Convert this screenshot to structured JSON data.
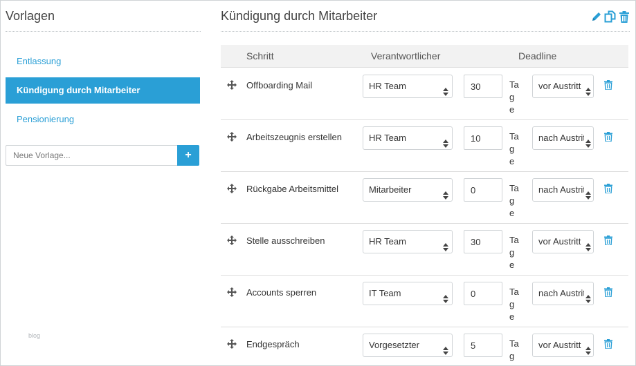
{
  "sidebar": {
    "title": "Vorlagen",
    "items": [
      {
        "label": "Entlassung",
        "active": false
      },
      {
        "label": "Kündigung durch Mitarbeiter",
        "active": true
      },
      {
        "label": "Pensionierung",
        "active": false
      }
    ],
    "new_placeholder": "Neue Vorlage...",
    "add_label": "+",
    "footer": "blog"
  },
  "main": {
    "title": "Kündigung durch Mitarbeiter",
    "actions": [
      "pencil-icon",
      "copy-icon",
      "trash-icon"
    ],
    "columns": {
      "step": "Schritt",
      "owner": "Verantwortlicher",
      "deadline": "Deadline"
    },
    "unit_label": "Tage",
    "rows": [
      {
        "step": "Offboarding Mail",
        "owner": "HR Team",
        "days": "30",
        "when": "vor Austritt"
      },
      {
        "step": "Arbeitszeugnis erstellen",
        "owner": "HR Team",
        "days": "10",
        "when": "nach Austritt"
      },
      {
        "step": "Rückgabe Arbeitsmittel",
        "owner": "Mitarbeiter",
        "days": "0",
        "when": "nach Austritt"
      },
      {
        "step": "Stelle ausschreiben",
        "owner": "HR Team",
        "days": "30",
        "when": "vor Austritt"
      },
      {
        "step": "Accounts sperren",
        "owner": "IT Team",
        "days": "0",
        "when": "nach Austritt"
      },
      {
        "step": "Endgespräch",
        "owner": "Vorgesetzter",
        "days": "5",
        "when": "vor Austritt"
      }
    ]
  },
  "colors": {
    "accent": "#2a9fd6",
    "border": "#cfd3d6",
    "header_bg": "#f2f2f2"
  }
}
